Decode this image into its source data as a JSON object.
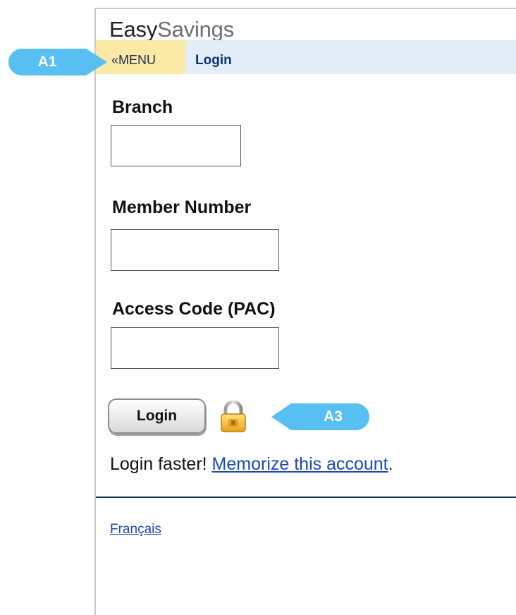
{
  "brand": {
    "easy": "Easy",
    "savings": "Savings"
  },
  "nav": {
    "menu_label": "«MENU",
    "page_title": "Login"
  },
  "annotations": {
    "a1": "A1",
    "a3": "A3"
  },
  "form": {
    "branch_label": "Branch",
    "branch_value": "",
    "member_label": "Member Number",
    "member_value": "",
    "access_label": "Access Code (PAC)",
    "access_value": "",
    "login_button": "Login"
  },
  "promo": {
    "prefix": "Login faster! ",
    "link_text": "Memorize this account",
    "suffix": "."
  },
  "footer": {
    "language_link": "Français"
  },
  "icons": {
    "lock": "lock-icon"
  },
  "colors": {
    "nav_background": "#e2edf7",
    "menu_background": "#fbe9a6",
    "callout": "#57bff1",
    "link": "#1b47b8",
    "divider": "#1b3258"
  }
}
